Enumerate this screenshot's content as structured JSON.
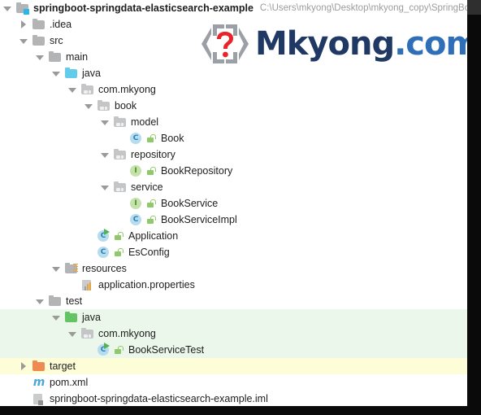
{
  "window": {
    "title": "springboot-springdata-elasticsearch-example",
    "project_path": "C:\\Users\\mkyong\\Desktop\\mkyong_copy\\SpringBoo"
  },
  "logo": {
    "mark": "question-mark-brackets",
    "name": "Mkyong",
    "suffix": ".com",
    "name_color": "#1f3864",
    "suffix_color": "#2e6fb7",
    "question_color": "#e8232a",
    "bracket_color": "#9aa0a6"
  },
  "colors": {
    "test_source_highlight": "#eaf7ea",
    "excluded_highlight": "#fdfdd8",
    "folder_gray": "#b2b4b6",
    "folder_source_cyan": "#63ccea",
    "folder_test_green": "#62c462",
    "folder_excluded_orange": "#ef8b50",
    "class_icon": "#b6dcf0",
    "interface_icon": "#c3e3ab",
    "path_text": "#9c9c9c"
  },
  "tree": {
    "name": "project-tree",
    "rows": [
      {
        "label": "springboot-springdata-elasticsearch-example",
        "icon": "project-root-folder-icon",
        "arrow": "down",
        "indent": 0,
        "bold": true,
        "path": "C:\\Users\\mkyong\\Desktop\\mkyong_copy\\SpringBoo",
        "highlight": "none"
      },
      {
        "label": ".idea",
        "icon": "folder-icon",
        "arrow": "right",
        "indent": 1,
        "bold": false,
        "path": "",
        "highlight": "none"
      },
      {
        "label": "src",
        "icon": "folder-icon",
        "arrow": "down",
        "indent": 1,
        "bold": false,
        "path": "",
        "highlight": "none"
      },
      {
        "label": "main",
        "icon": "folder-icon",
        "arrow": "down",
        "indent": 2,
        "bold": false,
        "path": "",
        "highlight": "none"
      },
      {
        "label": "java",
        "icon": "source-folder-icon",
        "arrow": "down",
        "indent": 3,
        "bold": false,
        "path": "",
        "highlight": "none"
      },
      {
        "label": "com.mkyong",
        "icon": "package-icon",
        "arrow": "down",
        "indent": 4,
        "bold": false,
        "path": "",
        "highlight": "none"
      },
      {
        "label": "book",
        "icon": "package-icon",
        "arrow": "down",
        "indent": 5,
        "bold": false,
        "path": "",
        "highlight": "none"
      },
      {
        "label": "model",
        "icon": "package-icon",
        "arrow": "down",
        "indent": 6,
        "bold": false,
        "path": "",
        "highlight": "none"
      },
      {
        "label": "Book",
        "icon": "java-class-icon",
        "arrow": "none",
        "indent": 7,
        "bold": false,
        "path": "",
        "highlight": "none"
      },
      {
        "label": "repository",
        "icon": "package-icon",
        "arrow": "down",
        "indent": 6,
        "bold": false,
        "path": "",
        "highlight": "none"
      },
      {
        "label": "BookRepository",
        "icon": "java-interface-icon",
        "arrow": "none",
        "indent": 7,
        "bold": false,
        "path": "",
        "highlight": "none"
      },
      {
        "label": "service",
        "icon": "package-icon",
        "arrow": "down",
        "indent": 6,
        "bold": false,
        "path": "",
        "highlight": "none"
      },
      {
        "label": "BookService",
        "icon": "java-interface-icon",
        "arrow": "none",
        "indent": 7,
        "bold": false,
        "path": "",
        "highlight": "none"
      },
      {
        "label": "BookServiceImpl",
        "icon": "java-class-icon",
        "arrow": "none",
        "indent": 7,
        "bold": false,
        "path": "",
        "highlight": "none"
      },
      {
        "label": "Application",
        "icon": "java-runnable-class-icon",
        "arrow": "none",
        "indent": 5,
        "bold": false,
        "path": "",
        "highlight": "none"
      },
      {
        "label": "EsConfig",
        "icon": "java-class-icon",
        "arrow": "none",
        "indent": 5,
        "bold": false,
        "path": "",
        "highlight": "none"
      },
      {
        "label": "resources",
        "icon": "resources-folder-icon",
        "arrow": "down",
        "indent": 3,
        "bold": false,
        "path": "",
        "highlight": "none"
      },
      {
        "label": "application.properties",
        "icon": "properties-file-icon",
        "arrow": "none",
        "indent": 4,
        "bold": false,
        "path": "",
        "highlight": "none"
      },
      {
        "label": "test",
        "icon": "folder-icon",
        "arrow": "down",
        "indent": 2,
        "bold": false,
        "path": "",
        "highlight": "none"
      },
      {
        "label": "java",
        "icon": "test-source-folder-icon",
        "arrow": "down",
        "indent": 3,
        "bold": false,
        "path": "",
        "highlight": "green"
      },
      {
        "label": "com.mkyong",
        "icon": "package-icon",
        "arrow": "down",
        "indent": 4,
        "bold": false,
        "path": "",
        "highlight": "green"
      },
      {
        "label": "BookServiceTest",
        "icon": "java-runnable-class-icon",
        "arrow": "none",
        "indent": 5,
        "bold": false,
        "path": "",
        "highlight": "green"
      },
      {
        "label": "target",
        "icon": "excluded-folder-icon",
        "arrow": "right",
        "indent": 1,
        "bold": false,
        "path": "",
        "highlight": "yellow"
      },
      {
        "label": "pom.xml",
        "icon": "maven-file-icon",
        "arrow": "none",
        "indent": 1,
        "bold": false,
        "path": "",
        "highlight": "none"
      },
      {
        "label": "springboot-springdata-elasticsearch-example.iml",
        "icon": "module-file-icon",
        "arrow": "none",
        "indent": 1,
        "bold": false,
        "path": "",
        "highlight": "none"
      }
    ]
  },
  "scrollbar": {
    "name": "vertical-scrollbar",
    "thumb_position": "top"
  }
}
